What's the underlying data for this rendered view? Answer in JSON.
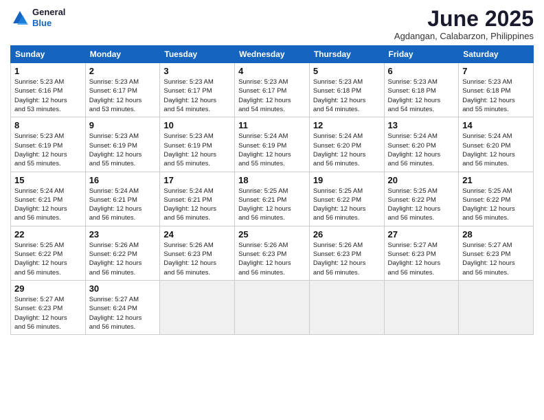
{
  "header": {
    "logo_line1": "General",
    "logo_line2": "Blue",
    "month_title": "June 2025",
    "location": "Agdangan, Calabarzon, Philippines"
  },
  "weekdays": [
    "Sunday",
    "Monday",
    "Tuesday",
    "Wednesday",
    "Thursday",
    "Friday",
    "Saturday"
  ],
  "weeks": [
    [
      {
        "day": "1",
        "detail": "Sunrise: 5:23 AM\nSunset: 6:16 PM\nDaylight: 12 hours\nand 53 minutes."
      },
      {
        "day": "2",
        "detail": "Sunrise: 5:23 AM\nSunset: 6:17 PM\nDaylight: 12 hours\nand 53 minutes."
      },
      {
        "day": "3",
        "detail": "Sunrise: 5:23 AM\nSunset: 6:17 PM\nDaylight: 12 hours\nand 54 minutes."
      },
      {
        "day": "4",
        "detail": "Sunrise: 5:23 AM\nSunset: 6:17 PM\nDaylight: 12 hours\nand 54 minutes."
      },
      {
        "day": "5",
        "detail": "Sunrise: 5:23 AM\nSunset: 6:18 PM\nDaylight: 12 hours\nand 54 minutes."
      },
      {
        "day": "6",
        "detail": "Sunrise: 5:23 AM\nSunset: 6:18 PM\nDaylight: 12 hours\nand 54 minutes."
      },
      {
        "day": "7",
        "detail": "Sunrise: 5:23 AM\nSunset: 6:18 PM\nDaylight: 12 hours\nand 55 minutes."
      }
    ],
    [
      {
        "day": "8",
        "detail": "Sunrise: 5:23 AM\nSunset: 6:19 PM\nDaylight: 12 hours\nand 55 minutes."
      },
      {
        "day": "9",
        "detail": "Sunrise: 5:23 AM\nSunset: 6:19 PM\nDaylight: 12 hours\nand 55 minutes."
      },
      {
        "day": "10",
        "detail": "Sunrise: 5:23 AM\nSunset: 6:19 PM\nDaylight: 12 hours\nand 55 minutes."
      },
      {
        "day": "11",
        "detail": "Sunrise: 5:24 AM\nSunset: 6:19 PM\nDaylight: 12 hours\nand 55 minutes."
      },
      {
        "day": "12",
        "detail": "Sunrise: 5:24 AM\nSunset: 6:20 PM\nDaylight: 12 hours\nand 56 minutes."
      },
      {
        "day": "13",
        "detail": "Sunrise: 5:24 AM\nSunset: 6:20 PM\nDaylight: 12 hours\nand 56 minutes."
      },
      {
        "day": "14",
        "detail": "Sunrise: 5:24 AM\nSunset: 6:20 PM\nDaylight: 12 hours\nand 56 minutes."
      }
    ],
    [
      {
        "day": "15",
        "detail": "Sunrise: 5:24 AM\nSunset: 6:21 PM\nDaylight: 12 hours\nand 56 minutes."
      },
      {
        "day": "16",
        "detail": "Sunrise: 5:24 AM\nSunset: 6:21 PM\nDaylight: 12 hours\nand 56 minutes."
      },
      {
        "day": "17",
        "detail": "Sunrise: 5:24 AM\nSunset: 6:21 PM\nDaylight: 12 hours\nand 56 minutes."
      },
      {
        "day": "18",
        "detail": "Sunrise: 5:25 AM\nSunset: 6:21 PM\nDaylight: 12 hours\nand 56 minutes."
      },
      {
        "day": "19",
        "detail": "Sunrise: 5:25 AM\nSunset: 6:22 PM\nDaylight: 12 hours\nand 56 minutes."
      },
      {
        "day": "20",
        "detail": "Sunrise: 5:25 AM\nSunset: 6:22 PM\nDaylight: 12 hours\nand 56 minutes."
      },
      {
        "day": "21",
        "detail": "Sunrise: 5:25 AM\nSunset: 6:22 PM\nDaylight: 12 hours\nand 56 minutes."
      }
    ],
    [
      {
        "day": "22",
        "detail": "Sunrise: 5:25 AM\nSunset: 6:22 PM\nDaylight: 12 hours\nand 56 minutes."
      },
      {
        "day": "23",
        "detail": "Sunrise: 5:26 AM\nSunset: 6:22 PM\nDaylight: 12 hours\nand 56 minutes."
      },
      {
        "day": "24",
        "detail": "Sunrise: 5:26 AM\nSunset: 6:23 PM\nDaylight: 12 hours\nand 56 minutes."
      },
      {
        "day": "25",
        "detail": "Sunrise: 5:26 AM\nSunset: 6:23 PM\nDaylight: 12 hours\nand 56 minutes."
      },
      {
        "day": "26",
        "detail": "Sunrise: 5:26 AM\nSunset: 6:23 PM\nDaylight: 12 hours\nand 56 minutes."
      },
      {
        "day": "27",
        "detail": "Sunrise: 5:27 AM\nSunset: 6:23 PM\nDaylight: 12 hours\nand 56 minutes."
      },
      {
        "day": "28",
        "detail": "Sunrise: 5:27 AM\nSunset: 6:23 PM\nDaylight: 12 hours\nand 56 minutes."
      }
    ],
    [
      {
        "day": "29",
        "detail": "Sunrise: 5:27 AM\nSunset: 6:23 PM\nDaylight: 12 hours\nand 56 minutes."
      },
      {
        "day": "30",
        "detail": "Sunrise: 5:27 AM\nSunset: 6:24 PM\nDaylight: 12 hours\nand 56 minutes."
      },
      {
        "day": "",
        "detail": ""
      },
      {
        "day": "",
        "detail": ""
      },
      {
        "day": "",
        "detail": ""
      },
      {
        "day": "",
        "detail": ""
      },
      {
        "day": "",
        "detail": ""
      }
    ]
  ]
}
